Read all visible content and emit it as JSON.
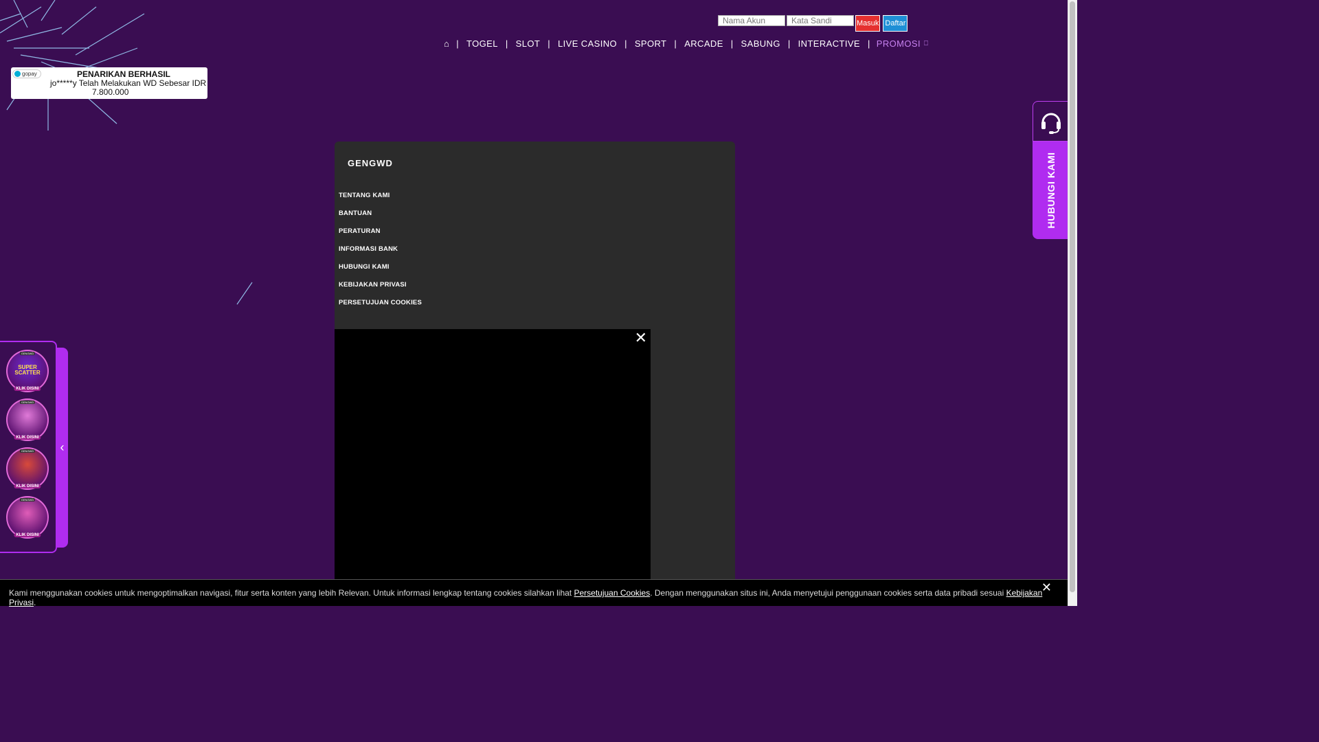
{
  "header": {
    "username_placeholder": "Nama Akun",
    "password_placeholder": "Kata Sandi",
    "login_label": "Masuk",
    "register_label": "Daftar"
  },
  "nav": {
    "home_icon": "home-icon",
    "separator": "|",
    "items": [
      "TOGEL",
      "SLOT",
      "LIVE CASINO",
      "SPORT",
      "ARCADE",
      "SABUNG",
      "INTERACTIVE"
    ],
    "promo_label": "PROMOSI",
    "promo_icon": "gift-icon"
  },
  "withdraw_toast": {
    "provider": "gopay",
    "title": "PENARIKAN BERHASIL",
    "line1": "jo*****y Telah Melakukan WD Sebesar IDR",
    "line2": "7.800.000"
  },
  "footer_panel": {
    "logo_text": "GENGWD",
    "links": [
      "TENTANG KAMI",
      "BANTUAN",
      "PERATURAN",
      "INFORMASI BANK",
      "HUBUNGI KAMI",
      "KEBIJAKAN PRIVASI",
      "PERSETUJUAN COOKIES"
    ]
  },
  "video": {
    "close_glyph": "✕"
  },
  "contact": {
    "label": "HUBUNGI KAMI",
    "icon": "headset-icon"
  },
  "games_sidebar": {
    "toggle_glyph": "‹",
    "games": [
      {
        "title": "SUPER SCATTER",
        "badge": "KLIK DISINI",
        "brand": "GENGWD",
        "color": "#6b2bd1"
      },
      {
        "title": "",
        "badge": "KLIK DISINI",
        "brand": "GENGWD",
        "color": "#e07ad8"
      },
      {
        "title": "",
        "badge": "KLIK DISINI",
        "brand": "GENGWD",
        "color": "#d84a3a"
      },
      {
        "title": "",
        "badge": "KLIK DISINI",
        "brand": "GENGWD",
        "color": "#e05db8"
      }
    ]
  },
  "cookie_bar": {
    "text1": "Kami menggunakan cookies untuk mengoptimalkan navigasi, fitur serta konten yang lebih Relevan. Untuk informasi lengkap tentang cookies silahkan lihat ",
    "link1": "Persetujuan Cookies",
    "text2": ". Dengan menggunakan situs ini, Anda menyetujui penggunaan cookies serta data pribadi sesuai ",
    "link2": "Kebijakan Privasi",
    "text3": ".",
    "close_glyph": "✕"
  },
  "colors": {
    "background": "#3a0d52",
    "accent": "#b02cf0",
    "promo": "#c782f0",
    "login_button": "#e5302f",
    "register_button": "#1f8fd6"
  }
}
